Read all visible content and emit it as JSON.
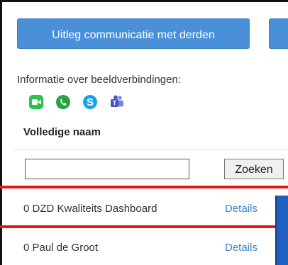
{
  "toolbar": {
    "primary_button_label": "Uitleg communicatie met derden"
  },
  "video_info": {
    "label": "Informatie over beeldverbindingen:",
    "icons": [
      "facetime-icon",
      "whatsapp-icon",
      "skype-icon",
      "teams-icon"
    ]
  },
  "table": {
    "column_header": "Volledige naam",
    "search_input_value": "",
    "search_button_label": "Zoeken",
    "rows": [
      {
        "name": "0 DZD Kwaliteits Dashboard",
        "link": "Details"
      },
      {
        "name": "0 Paul de Groot",
        "link": "Details"
      }
    ]
  },
  "colors": {
    "button_blue": "#4a90d9",
    "link_blue": "#3b83c8",
    "highlight_red": "#e8141a",
    "panel_blue": "#1f5fbf"
  }
}
